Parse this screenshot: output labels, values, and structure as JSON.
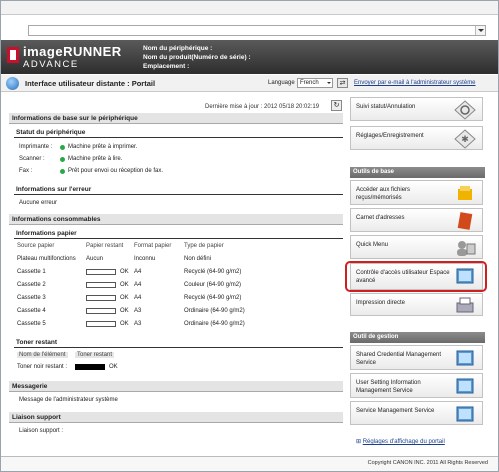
{
  "brand": {
    "line1": "imageRUNNER",
    "line2": "ADVANCE"
  },
  "device_info": {
    "name_label": "Nom du périphérique :",
    "product_label": "Nom du produit(Numéro de série) :",
    "location_label": "Emplacement :"
  },
  "titlebar": {
    "title": "Interface utilisateur distante : Portail",
    "language_label": "Language",
    "language_value": "French",
    "email_link": "Envoyer par e-mail à l'administrateur système"
  },
  "main": {
    "last_update": "Dernière mise à jour : 2012 05/18 20:02:19",
    "basic_info_title": "Informations de base sur le périphérique",
    "device_status_title": "Statut du périphérique",
    "statuses": [
      {
        "label": "Imprimante :",
        "value": "Machine prête à imprimer."
      },
      {
        "label": "Scanner :",
        "value": "Machine prête à lire."
      },
      {
        "label": "Fax :",
        "value": "Prêt pour envoi ou réception de fax."
      }
    ],
    "error_title": "Informations sur l'erreur",
    "error_value": "Aucune erreur",
    "consumables_title": "Informations consommables",
    "paper_title": "Informations papier",
    "paper_headers": [
      "Source papier",
      "Papier restant",
      "Format papier",
      "Type de papier"
    ],
    "paper_rows": [
      {
        "source": "Plateau multifonctions",
        "remaining": "Aucun",
        "size": "Inconnu",
        "type": "Non défini",
        "bar": null,
        "ok": ""
      },
      {
        "source": "Cassette 1",
        "remaining": "",
        "size": "A4",
        "type": "Recyclé (64-90 g/m2)",
        "bar": 1,
        "ok": "OK"
      },
      {
        "source": "Cassette 2",
        "remaining": "",
        "size": "A4",
        "type": "Couleur (64-90 g/m2)",
        "bar": 1,
        "ok": "OK"
      },
      {
        "source": "Cassette 3",
        "remaining": "",
        "size": "A4",
        "type": "Recyclé (64-90 g/m2)",
        "bar": 1,
        "ok": "OK"
      },
      {
        "source": "Cassette 4",
        "remaining": "",
        "size": "A3",
        "type": "Ordinaire (64-90 g/m2)",
        "bar": 1,
        "ok": "OK"
      },
      {
        "source": "Cassette 5",
        "remaining": "",
        "size": "A3",
        "type": "Ordinaire (64-90 g/m2)",
        "bar": 1,
        "ok": "OK"
      }
    ],
    "toner_title": "Toner restant",
    "toner_headers": [
      "Nom de l'élément",
      "Toner restant"
    ],
    "toner_row": {
      "name": "Toner noir restant :",
      "level": 1,
      "ok": "OK"
    },
    "messaging_title": "Messagerie",
    "messaging_value": "Message de l'administrateur système",
    "support_title": "Liaison support",
    "support_value": "Liaison support :"
  },
  "right": {
    "status_button": "Suivi statut/Annulation",
    "settings_button": "Réglages/Enregistrement",
    "basic_tools_title": "Outils de base",
    "basic_tools": [
      {
        "label": "Accéder aux fichiers reçus/mémorisés",
        "icon": "files-icon"
      },
      {
        "label": "Carnet d'adresses",
        "icon": "address-book-icon"
      },
      {
        "label": "Quick Menu",
        "icon": "quick-menu-icon"
      },
      {
        "label": "Contrôle d'accès utilisateur Espace avancé",
        "icon": "advanced-space-icon"
      },
      {
        "label": "Impression directe",
        "icon": "printer-icon"
      }
    ],
    "mgmt_title": "Outil de gestion",
    "mgmt_tools": [
      {
        "label": "Shared Credential Management Service"
      },
      {
        "label": "User Setting Information Management Service"
      },
      {
        "label": "Service Management Service"
      }
    ],
    "portal_settings_link": "Réglages d'affichage du portail"
  },
  "footer": {
    "copyright": "Copyright CANON INC. 2011 All Rights Reserved"
  },
  "colors": {
    "highlight": "#d01f1f",
    "status_green": "#29a84a",
    "header_dark": "#2d2d2d"
  }
}
